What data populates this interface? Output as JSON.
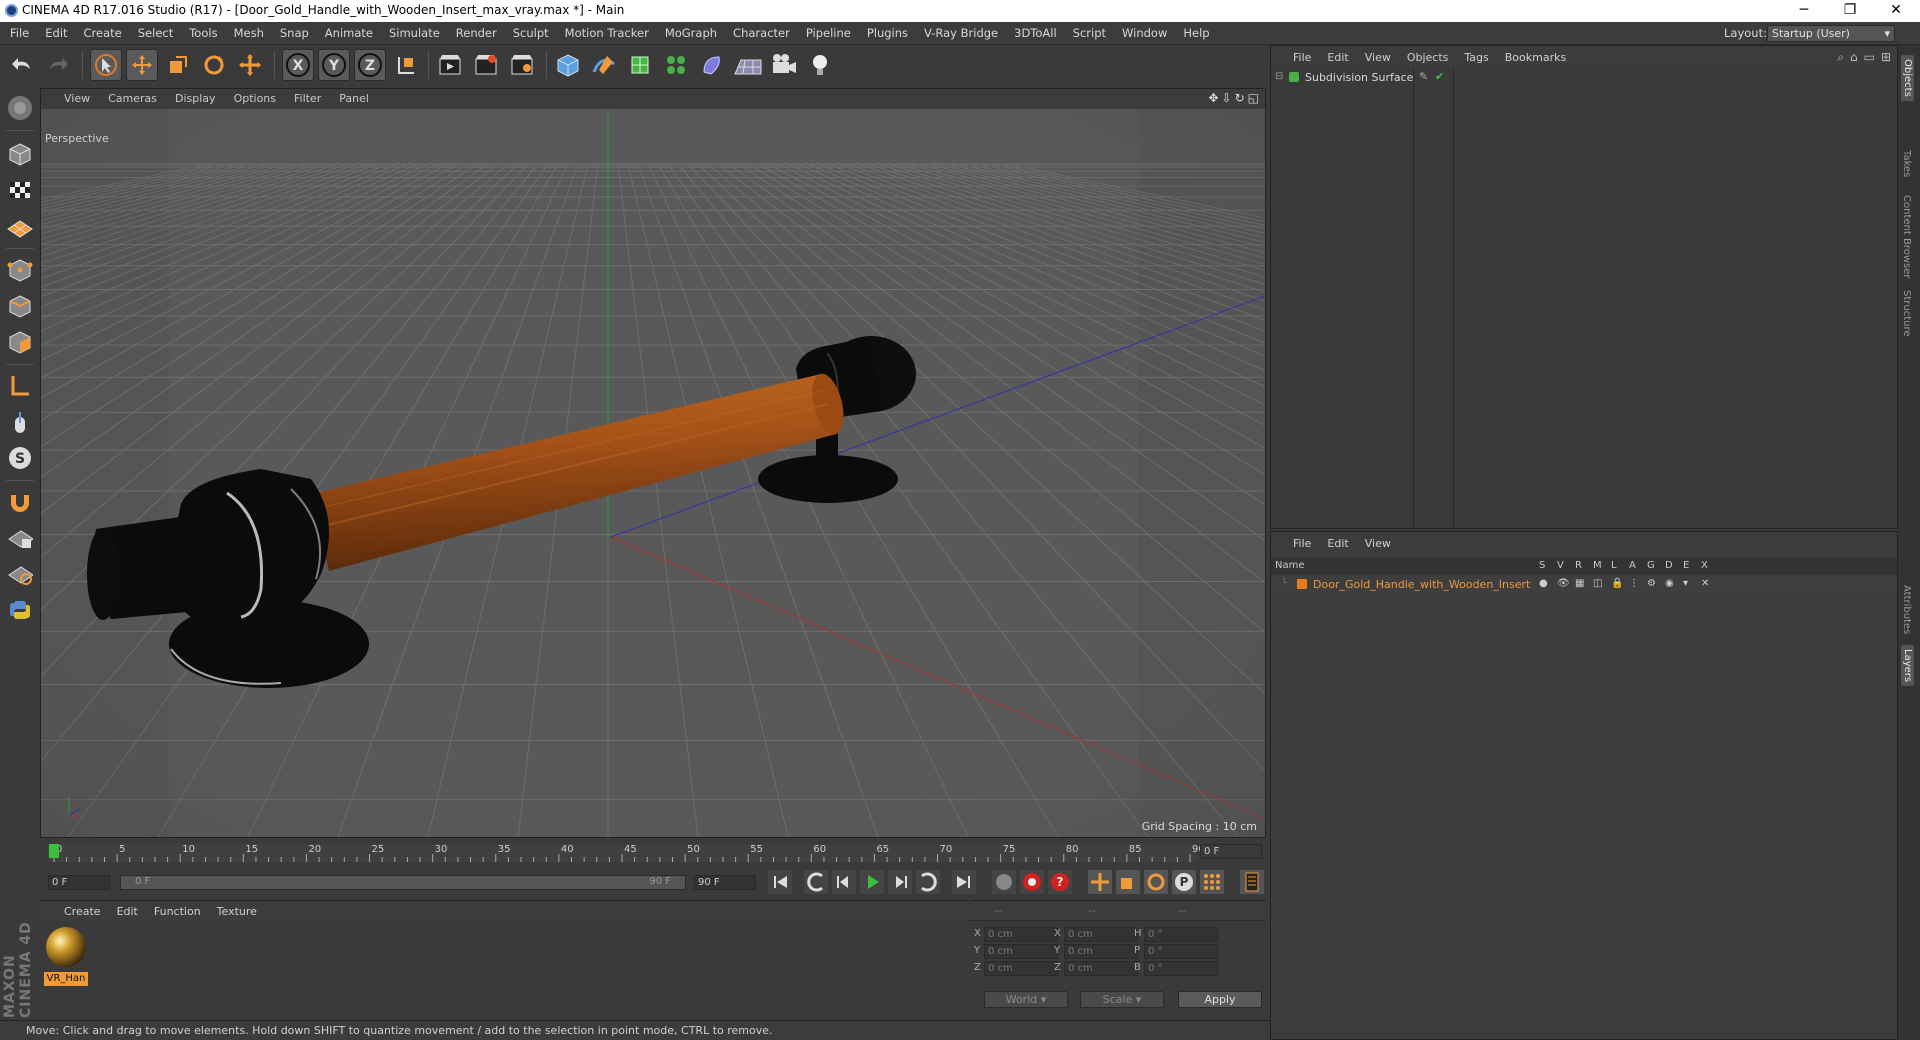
{
  "window": {
    "title": "CINEMA 4D R17.016 Studio (R17) - [Door_Gold_Handle_with_Wooden_Insert_max_vray.max *] - Main",
    "minimize": "─",
    "maximize": "❐",
    "close": "✕"
  },
  "menu": {
    "items": [
      "File",
      "Edit",
      "Create",
      "Select",
      "Tools",
      "Mesh",
      "Snap",
      "Animate",
      "Simulate",
      "Render",
      "Sculpt",
      "Motion Tracker",
      "MoGraph",
      "Character",
      "Pipeline",
      "Plugins",
      "V-Ray Bridge",
      "3DToAll",
      "Script",
      "Window",
      "Help"
    ],
    "layout_label": "Layout:",
    "layout_value": "Startup (User)"
  },
  "toolbar": {
    "axis_x": "X",
    "axis_y": "Y",
    "axis_z": "Z"
  },
  "viewport": {
    "menu": [
      "View",
      "Cameras",
      "Display",
      "Options",
      "Filter",
      "Panel"
    ],
    "label": "Perspective",
    "grid_spacing": "Grid Spacing : 10 cm",
    "colors": {
      "bg": "#5a5a5a",
      "grid": "#6e6e6e",
      "wood": "#a05218",
      "black": "#0b0b0b",
      "x_axis": "#b03030",
      "y_axis": "#2fa02f",
      "z_axis": "#3030b0"
    }
  },
  "timeline": {
    "ticks": [
      "0",
      "5",
      "10",
      "15",
      "20",
      "25",
      "30",
      "35",
      "40",
      "45",
      "50",
      "55",
      "60",
      "65",
      "70",
      "75",
      "80",
      "85",
      "90"
    ],
    "current_frame": "0 F"
  },
  "time_controls": {
    "start_field": "0 F",
    "range_start": "0 F",
    "range_end": "90 F",
    "end_field": "90 F"
  },
  "materials": {
    "menu": [
      "Create",
      "Edit",
      "Function",
      "Texture"
    ],
    "items": [
      {
        "name": "VR_Han"
      }
    ]
  },
  "coordinates": {
    "headers": [
      "--",
      "--",
      "--"
    ],
    "rows": [
      {
        "l1": "X",
        "v1": "0 cm",
        "l2": "X",
        "v2": "0 cm",
        "l3": "H",
        "v3": "0 °"
      },
      {
        "l1": "Y",
        "v1": "0 cm",
        "l2": "Y",
        "v2": "0 cm",
        "l3": "P",
        "v3": "0 °"
      },
      {
        "l1": "Z",
        "v1": "0 cm",
        "l2": "Z",
        "v2": "0 cm",
        "l3": "B",
        "v3": "0 °"
      }
    ],
    "world": "World",
    "scale": "Scale",
    "apply": "Apply"
  },
  "status": "Move: Click and drag to move elements. Hold down SHIFT to quantize movement / add to the selection in point mode, CTRL to remove.",
  "brand": "MAXON CINEMA 4D",
  "objects_panel": {
    "menu": [
      "File",
      "Edit",
      "View",
      "Objects",
      "Tags",
      "Bookmarks"
    ],
    "tree": [
      {
        "name": "Subdivision Surface"
      }
    ]
  },
  "layers_panel": {
    "menu": [
      "File",
      "Edit",
      "View"
    ],
    "columns": [
      "Name",
      "S",
      "V",
      "R",
      "M",
      "L",
      "A",
      "G",
      "D",
      "E",
      "X"
    ],
    "rows": [
      {
        "name": "Door_Gold_Handle_with_Wooden_Insert",
        "color": "#e87a1a"
      }
    ]
  },
  "right_tabs": [
    "Objects",
    "Takes",
    "Content Browser",
    "Structure",
    "Attributes",
    "Layers"
  ]
}
